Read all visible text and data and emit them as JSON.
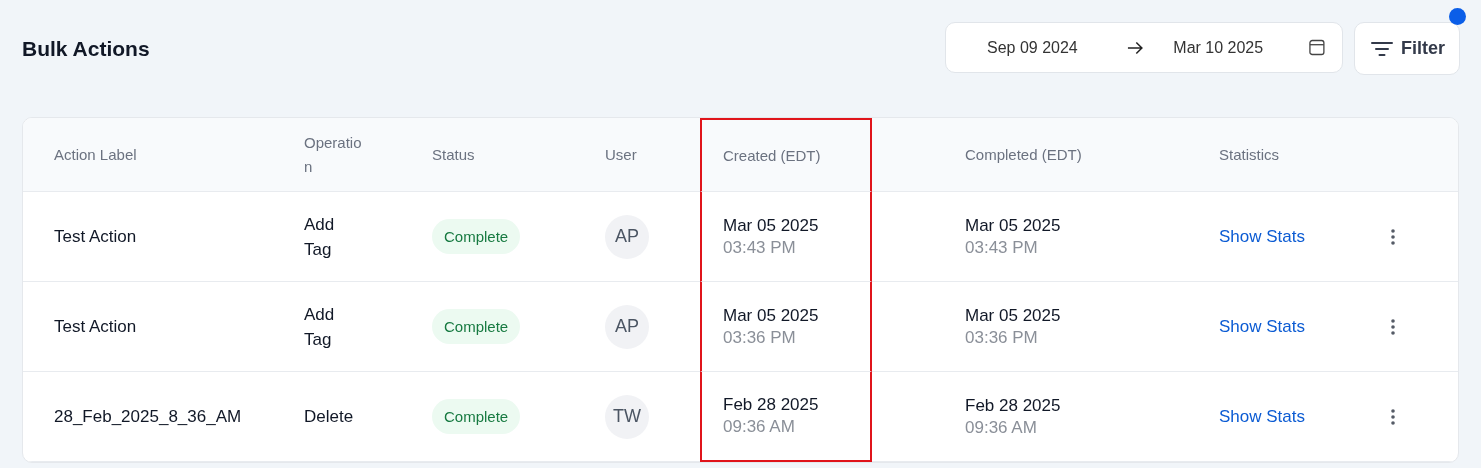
{
  "page": {
    "title": "Bulk Actions"
  },
  "date_range": {
    "start": "Sep 09 2024",
    "end": "Mar 10 2025"
  },
  "filter": {
    "label": "Filter",
    "notification": true
  },
  "table": {
    "columns": [
      {
        "label": "Action Label",
        "highlighted": false
      },
      {
        "label": "Operation",
        "highlighted": false
      },
      {
        "label": "Status",
        "highlighted": false
      },
      {
        "label": "User",
        "highlighted": false
      },
      {
        "label": "Created (EDT)",
        "highlighted": true
      },
      {
        "label": "Completed (EDT)",
        "highlighted": false
      },
      {
        "label": "Statistics",
        "highlighted": false
      }
    ],
    "rows": [
      {
        "action_label": "Test Action",
        "operation": "Add Tag",
        "status": {
          "label": "Complete",
          "kind": "complete"
        },
        "user": "AP",
        "created": {
          "date": "Mar 05 2025",
          "time": "03:43 PM"
        },
        "completed": {
          "date": "Mar 05 2025",
          "time": "03:43 PM"
        },
        "statistics": "Show Stats"
      },
      {
        "action_label": "Test Action",
        "operation": "Add Tag",
        "status": {
          "label": "Complete",
          "kind": "complete"
        },
        "user": "AP",
        "created": {
          "date": "Mar 05 2025",
          "time": "03:36 PM"
        },
        "completed": {
          "date": "Mar 05 2025",
          "time": "03:36 PM"
        },
        "statistics": "Show Stats"
      },
      {
        "action_label": "28_Feb_2025_8_36_AM",
        "operation": "Delete",
        "status": {
          "label": "Complete",
          "kind": "complete"
        },
        "user": "TW",
        "created": {
          "date": "Feb 28 2025",
          "time": "09:36 AM"
        },
        "completed": {
          "date": "Feb 28 2025",
          "time": "09:36 AM"
        },
        "statistics": "Show Stats"
      }
    ]
  }
}
